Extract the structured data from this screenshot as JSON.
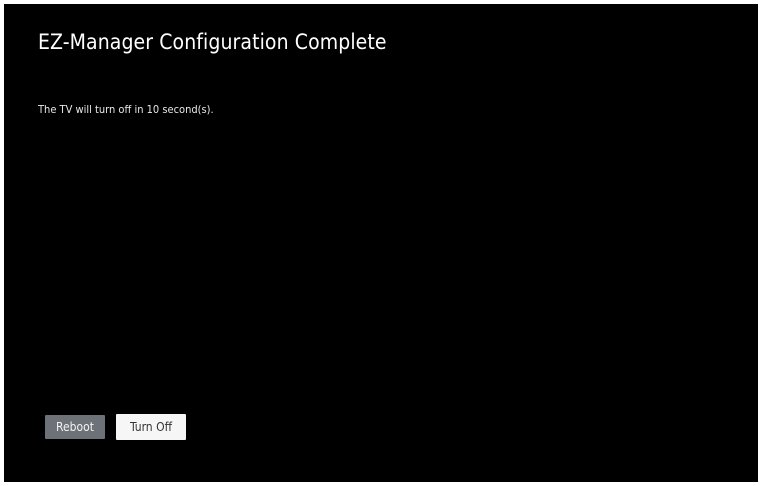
{
  "dialog": {
    "title": "EZ-Manager Configuration Complete",
    "message": "The TV will turn off in 10 second(s)."
  },
  "buttons": {
    "reboot_label": "Reboot",
    "turn_off_label": "Turn Off"
  },
  "colors": {
    "background": "#000000",
    "reboot_button": "#6d7278",
    "turn_off_button": "#f6f6f6"
  }
}
